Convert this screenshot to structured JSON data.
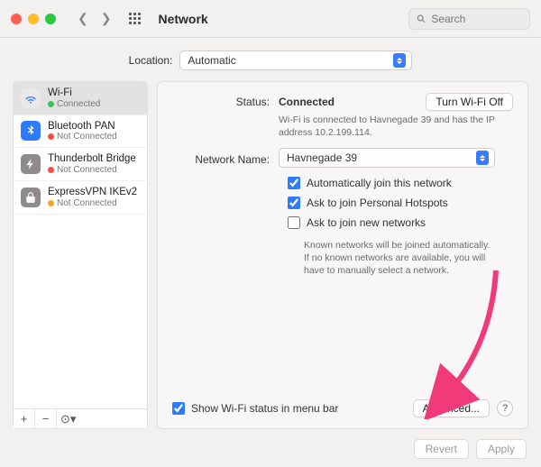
{
  "window": {
    "title": "Network"
  },
  "search": {
    "placeholder": "Search"
  },
  "location": {
    "label": "Location:",
    "value": "Automatic"
  },
  "sidebar": {
    "items": [
      {
        "name": "Wi-Fi",
        "status": "Connected",
        "dot": "green",
        "icon": "wifi",
        "iconbg": "#e9e9e9",
        "iconfg": "#4a87ff",
        "selected": true
      },
      {
        "name": "Bluetooth PAN",
        "status": "Not Connected",
        "dot": "red",
        "icon": "bluetooth",
        "iconbg": "#2f7bff",
        "iconfg": "#ffffff",
        "selected": false
      },
      {
        "name": "Thunderbolt Bridge",
        "status": "Not Connected",
        "dot": "red",
        "icon": "thunderbolt",
        "iconbg": "#8f8b8b",
        "iconfg": "#ffffff",
        "selected": false
      },
      {
        "name": "ExpressVPN IKEv2",
        "status": "Not Connected",
        "dot": "amber",
        "icon": "lock",
        "iconbg": "#8f8b8b",
        "iconfg": "#ffffff",
        "selected": false
      }
    ]
  },
  "detail": {
    "status_label": "Status:",
    "status_value": "Connected",
    "turn_off": "Turn Wi-Fi Off",
    "status_sub": "Wi-Fi is connected to Havnegade 39 and has the IP address 10.2.199.114.",
    "network_label": "Network Name:",
    "network_value": "Havnegade 39",
    "cb_auto": "Automatically join this network",
    "cb_hotspot": "Ask to join Personal Hotspots",
    "cb_newnet": "Ask to join new networks",
    "newnet_hint": "Known networks will be joined automatically. If no known networks are available, you will have to manually select a network.",
    "cb_menubar": "Show Wi-Fi status in menu bar",
    "advanced": "Advanced...",
    "help": "?"
  },
  "footer": {
    "revert": "Revert",
    "apply": "Apply"
  },
  "annotation": {
    "arrow_color": "#f03a7a"
  }
}
